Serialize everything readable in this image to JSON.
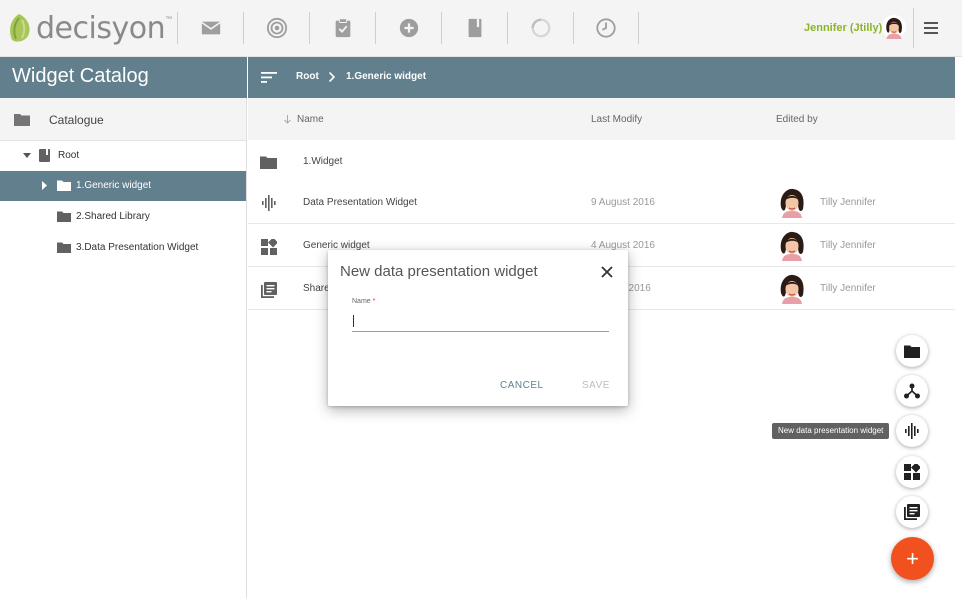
{
  "brand": {
    "name": "decisyon",
    "tm": "™"
  },
  "topbar": {
    "nav_icons": [
      "mail-icon",
      "radar-icon",
      "clipboard-check-icon",
      "add-circle-icon",
      "book-icon",
      "loading-icon",
      "clock-icon"
    ],
    "user_name": "Jennifer (Jtilly)",
    "menu_icon": "hamburger-menu-icon"
  },
  "left": {
    "title": "Widget Catalog",
    "catalogue_label": "Catalogue",
    "tree": [
      {
        "label": "Root",
        "level": 0,
        "expanded": true,
        "icon": "book-icon"
      },
      {
        "label": "1.Generic widget",
        "level": 1,
        "selected": true,
        "icon": "folder-icon"
      },
      {
        "label": "2.Shared Library",
        "level": 1,
        "icon": "folder-icon"
      },
      {
        "label": "3.Data Presentation Widget",
        "level": 1,
        "icon": "folder-icon"
      }
    ]
  },
  "breadcrumb": {
    "root": "Root",
    "current": "1.Generic widget"
  },
  "table": {
    "headers": {
      "name": "Name",
      "last_modify": "Last Modify",
      "edited_by": "Edited by"
    },
    "rows": [
      {
        "icon": "folder-icon",
        "name": "1.Widget",
        "date": "",
        "editor": ""
      },
      {
        "icon": "waveform-icon",
        "name": "Data Presentation Widget",
        "date": "9 August 2016",
        "editor": "Tilly Jennifer"
      },
      {
        "icon": "dashboard-icon",
        "name": "Generic widget",
        "date": "4 August 2016",
        "editor": "Tilly Jennifer"
      },
      {
        "icon": "library-icon",
        "name": "Share",
        "date": "t 2016",
        "editor": "Tilly Jennifer"
      }
    ]
  },
  "fabs": {
    "tooltip": "New data presentation widget",
    "items": [
      "folder-icon",
      "hierarchy-icon",
      "waveform-icon",
      "dashboard-icon",
      "library-icon"
    ],
    "main_symbol": "+"
  },
  "dialog": {
    "title": "New data presentation widget",
    "field_label": "Name",
    "required_mark": "*",
    "value": "",
    "cancel": "CANCEL",
    "save": "SAVE"
  },
  "colors": {
    "accent": "#617f8d",
    "fab": "#f1501f",
    "user": "#8cb42a"
  }
}
